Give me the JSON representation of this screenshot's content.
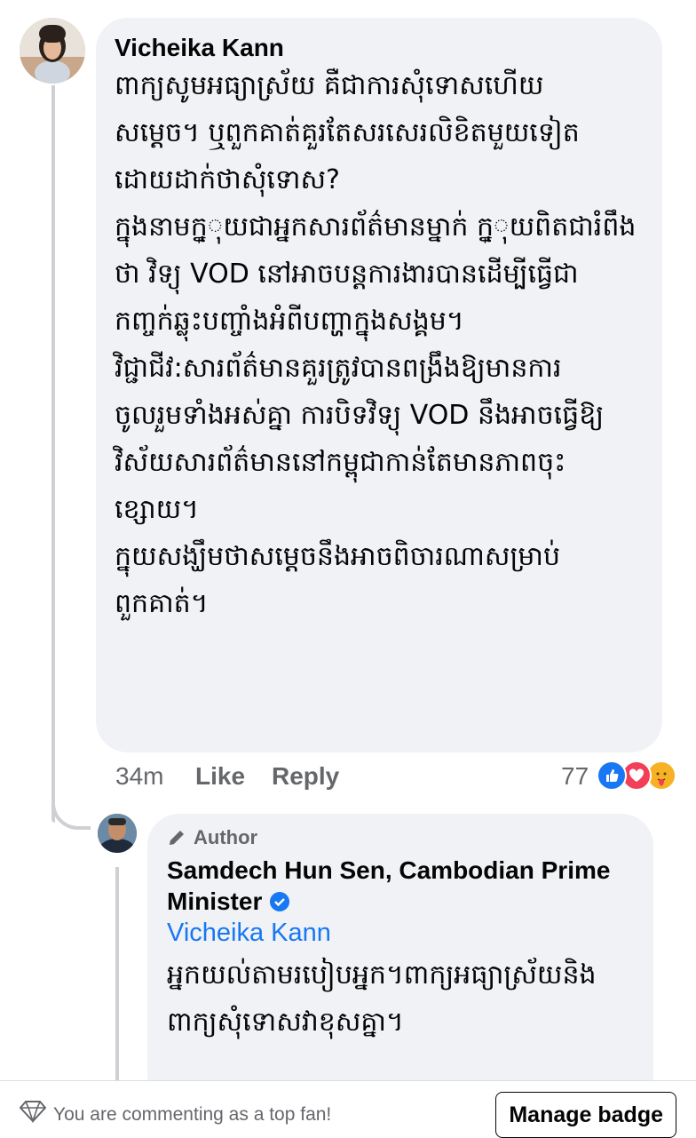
{
  "comment": {
    "author": "Vicheika Kann",
    "paragraphs": [
      "ពាក្យសូមអធ្យាស្រ័យ គឺជាការសុំទោសហើយ\nសម្តេច។ ឬពួកគាត់គួរតែសរសេរលិខិតមួយទៀត\nដោយដាក់ថាសុំទោស?",
      "ក្នុងនាមក្ន្ុយជាអ្នកសារព័ត៌មានម្នាក់ ក្ន្ុយពិតជារំពឹង\nថា វិទ្យុ VOD នៅអាចបន្តការងារបានដើម្បីធ្វើជា\nកញ្ចក់ឆ្លុះបញ្ចាំងអំពីបញ្ហាក្នុងសង្គម។",
      "វិជ្ជាជីវ:សារព័ត៌មានគួរត្រូវបានពង្រឹងឱ្យមានការ\nចូលរួមទាំងអស់គ្នា ការបិទវិទ្យុ VOD នឹងអាចធ្វើឱ្យ\nវិស័យសារព័ត៌មាននៅកម្ពុជាកាន់តែមានភាពចុះ\nខ្សោយ។",
      "ក្នុយសង្ឃឹមថាសម្តេចនឹងអាចពិចារណាសម្រាប់\nពួកគាត់។"
    ],
    "time": "34m",
    "like_label": "Like",
    "reply_label": "Reply",
    "reaction_count": "77",
    "reaction_icons": [
      "like-icon",
      "love-icon",
      "care-icon"
    ]
  },
  "reply": {
    "badge_label": "Author",
    "author": "Samdech Hun Sen, Cambodian Prime Minister",
    "verified": true,
    "mention": "Vicheika Kann",
    "text": "អ្នកយល់តាមរបៀបអ្នក។ពាក្យអធ្យាស្រ័យនិង\nពាក្យសុំទោសវាខុសគ្នា។"
  },
  "footer": {
    "status_text": "You are commenting as a top fan!",
    "button_label": "Manage badge"
  },
  "colors": {
    "bubble": "#f0f2f5",
    "link": "#1877f2",
    "meta": "#65676b"
  }
}
